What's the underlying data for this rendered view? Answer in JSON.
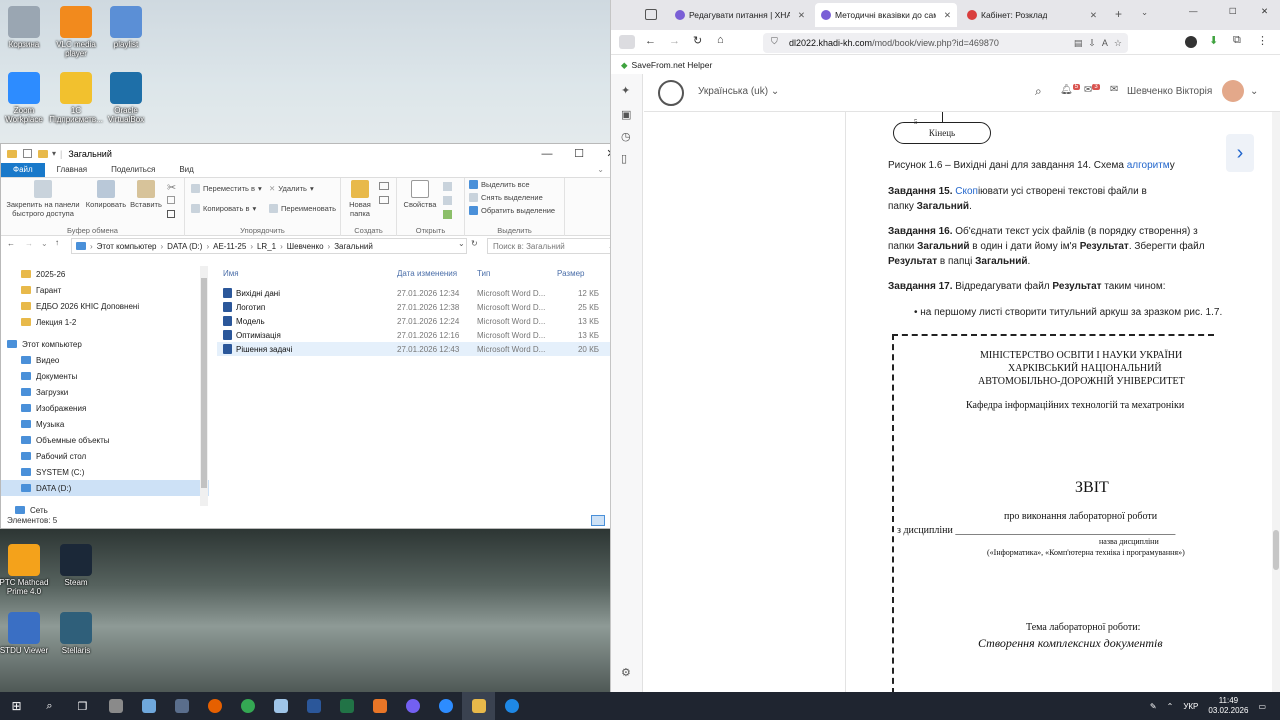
{
  "desktop": {
    "icons_top": [
      {
        "label": "Корзина",
        "color": "#9aa6b2"
      },
      {
        "label": "VLC media player",
        "color": "#f28a1d"
      },
      {
        "label": "playlist",
        "color": "#5b8fd6"
      },
      {
        "label": "Zoom Workplace",
        "color": "#2d8cff"
      },
      {
        "label": "1С Підприємств...",
        "color": "#f2c12e"
      },
      {
        "label": "Oracle VirtualBox",
        "color": "#1e6fa8"
      }
    ],
    "icons_bottom": [
      {
        "label": "PTC Mathcad Prime 4.0",
        "color": "#f4a21b"
      },
      {
        "label": "Steam",
        "color": "#1b2838"
      },
      {
        "label": "STDU Viewer",
        "color": "#3a6fc4"
      },
      {
        "label": "Stellaris",
        "color": "#2f5f7a"
      }
    ]
  },
  "explorer": {
    "title": "Загальний",
    "tabs": [
      "Файл",
      "Главная",
      "Поделиться",
      "Вид"
    ],
    "ribbon": {
      "pin": "Закрепить на панели быстрого доступа",
      "copy": "Копировать",
      "paste": "Вставить",
      "group_clipboard": "Буфер обмена",
      "move_to": "Переместить в",
      "copy_to": "Копировать в",
      "delete": "Удалить",
      "rename": "Переименовать",
      "group_organize": "Упорядочить",
      "new_folder": "Новая папка",
      "group_create": "Создать",
      "properties": "Свойства",
      "group_open": "Открыть",
      "select_all": "Выделить все",
      "select_none": "Снять выделение",
      "invert": "Обратить выделение",
      "group_select": "Выделить"
    },
    "breadcrumb": [
      "Этот компьютер",
      "DATA (D:)",
      "АЕ-11-25",
      "LR_1",
      "Шевченко",
      "Загальний"
    ],
    "search_placeholder": "Поиск в: Загальний",
    "nav": {
      "folders": [
        "2025-26",
        "Гарант",
        "ЕДБО 2026 КНІС Доповнені",
        "Лекция 1-2"
      ],
      "this_pc": "Этот компьютер",
      "pc_items": [
        "Видео",
        "Документы",
        "Загрузки",
        "Изображения",
        "Музыка",
        "Объемные объекты",
        "Рабочий стол",
        "SYSTEM (C:)",
        "DATA (D:)"
      ],
      "network": "Сеть"
    },
    "columns": {
      "name": "Имя",
      "date": "Дата изменения",
      "type": "Тип",
      "size": "Размер"
    },
    "files": [
      {
        "name": "Вихідні дані",
        "date": "27.01.2026 12:34",
        "type": "Microsoft Word D...",
        "size": "12 КБ"
      },
      {
        "name": "Логотип",
        "date": "27.01.2026 12:38",
        "type": "Microsoft Word D...",
        "size": "25 КБ"
      },
      {
        "name": "Модель",
        "date": "27.01.2026 12:24",
        "type": "Microsoft Word D...",
        "size": "13 КБ"
      },
      {
        "name": "Оптимізація",
        "date": "27.01.2026 12:16",
        "type": "Microsoft Word D...",
        "size": "13 КБ"
      },
      {
        "name": "Рішення задачі",
        "date": "27.01.2026 12:43",
        "type": "Microsoft Word D...",
        "size": "20 КБ"
      }
    ],
    "status": "Элементов: 5"
  },
  "browser": {
    "tabs": [
      "Редагувати питання | ХНАДУ",
      "Методичні вказівки до самос",
      "Кабінет: Розклад"
    ],
    "url_host": "dl2022.khadi-kh.com",
    "url_path": "/mod/book/view.php?id=469870",
    "bookmark": "SaveFrom.net Helper",
    "site": {
      "language": "Українська (uk)",
      "user": "Шевченко Вікторія",
      "badge_notif": "5",
      "badge_msg": "3"
    },
    "flow_step": "5",
    "flow_end": "Кінець",
    "caption_pre": "Рисунок 1.6 – Вихідні дані для завдання 14. Схема ",
    "caption_link": "алгоритм",
    "caption_post": "у",
    "task15_label": "Завдання 15.",
    "task15_link": "Скоп",
    "task15_text": "іювати усі створені текстові файли в папку ",
    "task15_bold": "Загальний",
    "task16_label": "Завдання 16.",
    "task16_text1": " Об'єднати текст усіх файлів (в порядку створення) з папки ",
    "task16_bold1": "Загальний",
    "task16_text2": " в один і дати йому ім'я ",
    "task16_bold2": "Результат",
    "task16_text3": ". Зберегти файл ",
    "task16_bold3": "Результат",
    "task16_text4": " в папці ",
    "task16_bold4": "Загальний",
    "task17_label": "Завдання 17.",
    "task17_text1": " Відредагувати файл ",
    "task17_bold": "Результат",
    "task17_text2": " таким чином:",
    "bullet": "на першому листі створити титульний аркуш за зразком рис. 1.7.",
    "doc": {
      "l1": "МІНІСТЕРСТВО ОСВІТИ І НАУКИ УКРАЇНИ",
      "l2": "ХАРКІВСЬКИЙ НАЦІОНАЛЬНИЙ",
      "l3": "АВТОМОБІЛЬНО-ДОРОЖНІЙ УНІВЕРСИТЕТ",
      "l4": "Кафедра інформаційних технологій та мехатроніки",
      "l5": "ЗВІТ",
      "l6": "про виконання лабораторної роботи",
      "l7": "з дисципліни",
      "l8": "назва дисципліни",
      "l9": "(«Інформатика», «Комп'ютерна техніка і програмування»)",
      "l10": "Тема лабораторної роботи:",
      "l11": "Створення комплексних документів"
    }
  },
  "taskbar": {
    "lang": "УКР",
    "time": "11:49",
    "date": "03.02.2026"
  },
  "colors": {
    "accent": "#1979ca",
    "taskbar": "#1f2530",
    "link": "#2266cc"
  }
}
